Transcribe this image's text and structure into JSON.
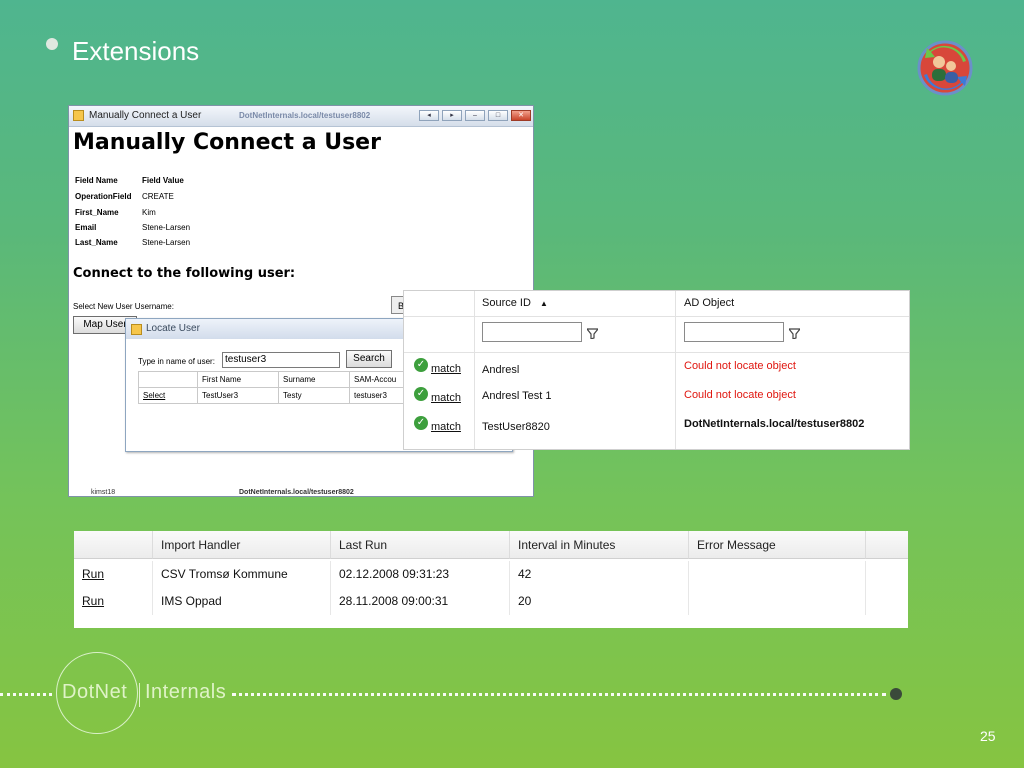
{
  "slide": {
    "title": "Extensions",
    "page_number": "25",
    "brand_left": "DotNet",
    "brand_right": "Internals"
  },
  "main_window": {
    "title": "Manually Connect a User",
    "url": "DotNetInternals.local/testuser8802",
    "heading": "Manually Connect a User",
    "fields_header": {
      "name": "Field Name",
      "value": "Field Value"
    },
    "fields": [
      {
        "name": "OperationField",
        "value": "CREATE"
      },
      {
        "name": "First_Name",
        "value": "Kim"
      },
      {
        "name": "Email",
        "value": "Stene-Larsen"
      },
      {
        "name": "Last_Name",
        "value": "Stene-Larsen"
      }
    ],
    "connect_heading": "Connect to the following user:",
    "select_label": "Select New User Username:",
    "browse_label": "B",
    "map_user_label": "Map User",
    "footer_left": "kimst18",
    "footer_url": "DotNetInternals.local/testuser8802"
  },
  "locate_dialog": {
    "title": "Locate User",
    "prompt": "Type in name of user:",
    "input_value": "testuser3",
    "search_label": "Search",
    "columns": [
      "",
      "First Name",
      "Surname",
      "SAM-Accou"
    ],
    "rows": [
      {
        "action": "Select",
        "first_name": "TestUser3",
        "surname": "Testy",
        "sam": "testuser3"
      }
    ]
  },
  "source_grid": {
    "col_source": "Source ID",
    "sort_icon": "▲",
    "col_ad": "AD Object",
    "rows": [
      {
        "action": "match",
        "source": "Andresl",
        "ad": "Could not locate object",
        "status": "error"
      },
      {
        "action": "match",
        "source": "Andresl Test 1",
        "ad": "Could not locate object",
        "status": "error"
      },
      {
        "action": "match",
        "source": "TestUser8820",
        "ad": "DotNetInternals.local/testuser8802",
        "status": "found"
      }
    ],
    "colors": {
      "error": "#e0160f",
      "check": "#3d9f3d"
    }
  },
  "import_grid": {
    "headers": [
      "",
      "Import Handler",
      "Last Run",
      "Interval in Minutes",
      "Error Message"
    ],
    "rows": [
      {
        "action": "Run",
        "handler": "CSV Tromsø Kommune",
        "last_run": "02.12.2008 09:31:23",
        "interval": "42",
        "error": ""
      },
      {
        "action": "Run",
        "handler": "IMS Oppad",
        "last_run": "28.11.2008 09:00:31",
        "interval": "20",
        "error": ""
      }
    ]
  },
  "colors": {
    "background_top": "#4fb58f",
    "background_bottom": "#86c441",
    "title_text": "#ffffff"
  },
  "icons": [
    "bullet-icon",
    "logo-icon",
    "window-icon",
    "funnel-icon",
    "check-icon"
  ]
}
